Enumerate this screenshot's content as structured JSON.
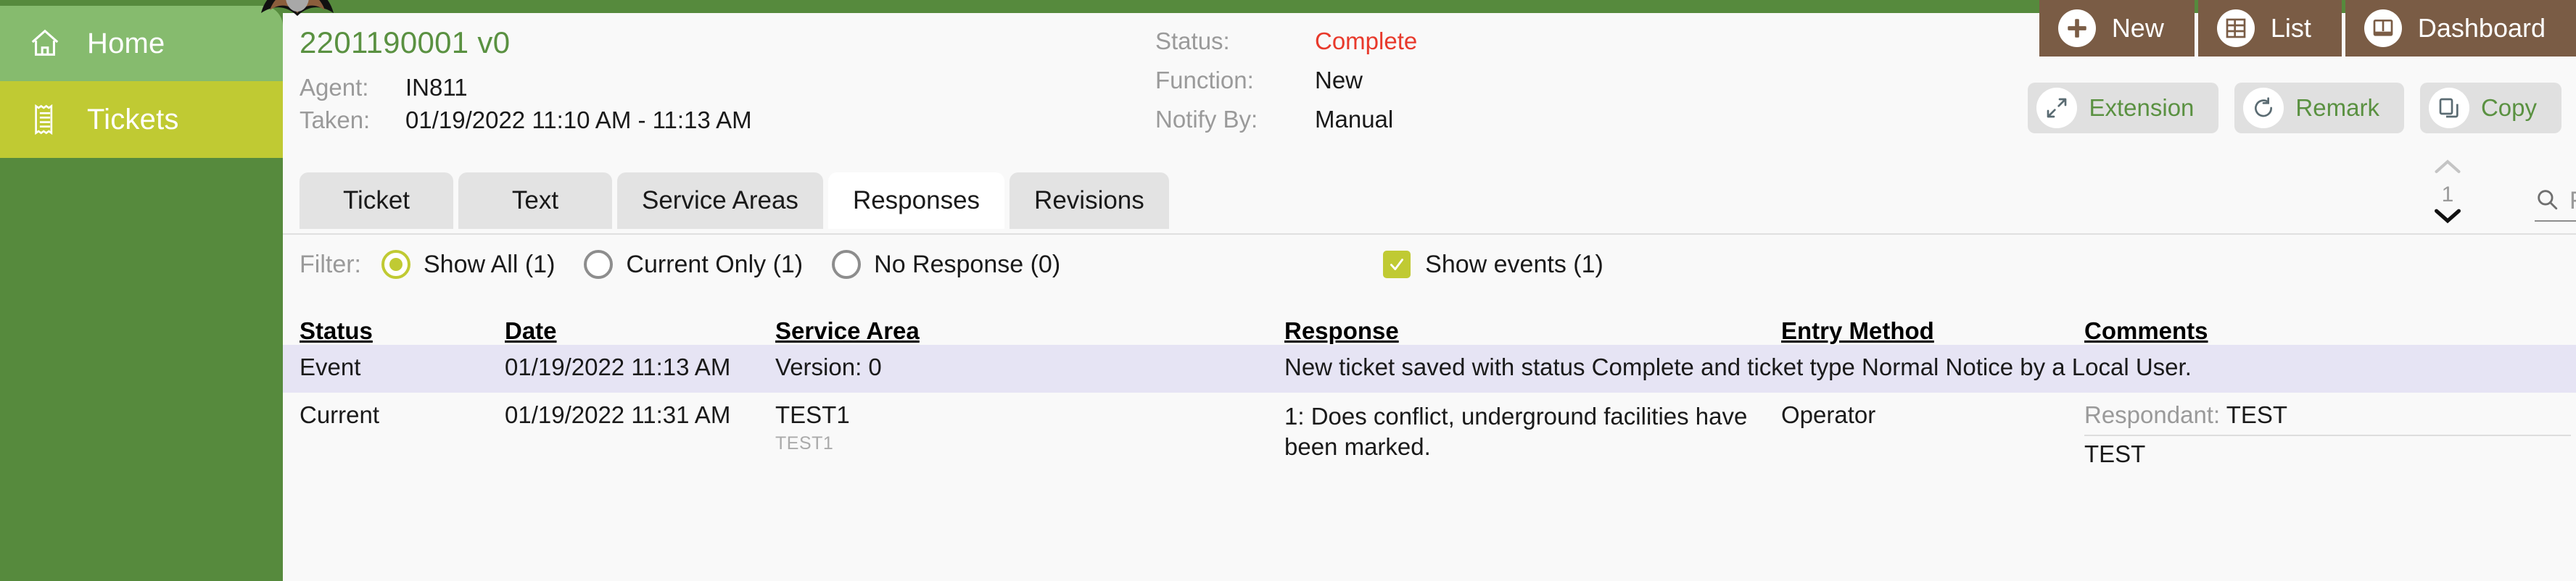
{
  "sidebar": {
    "items": [
      {
        "label": "Home",
        "icon": "home-icon",
        "selected": false
      },
      {
        "label": "Tickets",
        "icon": "ticket-icon",
        "selected": true
      }
    ]
  },
  "header": {
    "ticket_number": "2201190001 v0",
    "fields_left": [
      {
        "label": "Agent:",
        "value": "IN811"
      },
      {
        "label": "Taken:",
        "value": "01/19/2022 11:10 AM - 11:13 AM"
      }
    ],
    "fields_right": [
      {
        "label": "Status:",
        "value": "Complete",
        "color": "#e8392b"
      },
      {
        "label": "Function:",
        "value": "New",
        "color": "#1a1a1a"
      },
      {
        "label": "Notify By:",
        "value": "Manual",
        "color": "#1a1a1a"
      }
    ],
    "primary_buttons": [
      {
        "label": "New",
        "icon": "plus-icon"
      },
      {
        "label": "List",
        "icon": "grid-icon"
      },
      {
        "label": "Dashboard",
        "icon": "dashboard-icon"
      }
    ],
    "secondary_buttons": [
      {
        "label": "Extension",
        "icon": "expand-icon"
      },
      {
        "label": "Remark",
        "icon": "refresh-icon"
      },
      {
        "label": "Copy",
        "icon": "copy-icon"
      }
    ]
  },
  "tabs": [
    {
      "label": "Ticket",
      "active": false
    },
    {
      "label": "Text",
      "active": false
    },
    {
      "label": "Service Areas",
      "active": false
    },
    {
      "label": "Responses",
      "active": true
    },
    {
      "label": "Revisions",
      "active": false
    }
  ],
  "pagination": {
    "page": "1"
  },
  "search": {
    "placeholder": "Find by Ticket Number",
    "value": "",
    "icon": "search-icon"
  },
  "filter": {
    "label": "Filter:",
    "radios": [
      {
        "label": "Show All (1)",
        "selected": true
      },
      {
        "label": "Current Only (1)",
        "selected": false
      },
      {
        "label": "No Response (0)",
        "selected": false
      }
    ],
    "checkbox": {
      "label": "Show events (1)",
      "checked": true
    }
  },
  "table": {
    "columns": [
      "Status",
      "Date",
      "Service Area",
      "Response",
      "Entry Method",
      "Comments"
    ],
    "rows": [
      {
        "type": "event",
        "status": "Event",
        "date": "01/19/2022 11:13 AM",
        "service_area": "Version: 0",
        "service_area_sub": "",
        "response": "New ticket saved with status Complete and ticket type Normal Notice by a Local User.",
        "entry_method": "",
        "comment_label": "",
        "comment_value": "",
        "comment_extra": ""
      },
      {
        "type": "current",
        "status": "Current",
        "date": "01/19/2022 11:31 AM",
        "service_area": "TEST1",
        "service_area_sub": "TEST1",
        "response": "1: Does conflict, underground facilities have been marked.",
        "entry_method": "Operator",
        "comment_label": "Respondant:",
        "comment_value": "TEST",
        "comment_extra": "TEST"
      }
    ]
  },
  "colors": {
    "sidebar_green": "#568a3d",
    "home_green": "#86bb6e",
    "tickets_olive": "#c0ca33",
    "brand_green": "#5a9141",
    "brown": "#7a5c45",
    "status_red": "#e8392b",
    "event_row": "#e6e4f4"
  }
}
